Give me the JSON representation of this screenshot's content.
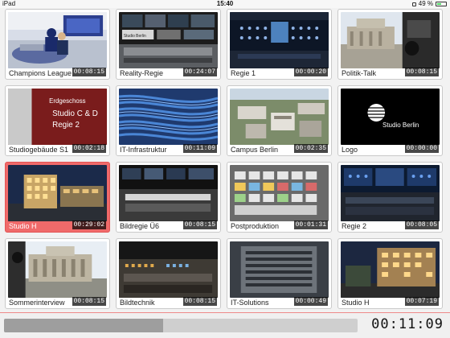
{
  "statusbar": {
    "device": "iPad",
    "time": "15:40",
    "battery_text": "49 %"
  },
  "tiles": [
    {
      "label": "Champions League",
      "duration": "00:08:15",
      "selected": false
    },
    {
      "label": "Reality-Regie",
      "duration": "00:24:07",
      "selected": false
    },
    {
      "label": "Regie 1",
      "duration": "00:00:20",
      "selected": false
    },
    {
      "label": "Politik-Talk",
      "duration": "00:08:15",
      "selected": false
    },
    {
      "label": "Studiogebäude S1",
      "duration": "00:02:18",
      "selected": false,
      "sign_lines": [
        "Erdgeschoss",
        "Studio C & D",
        "Regie 2"
      ]
    },
    {
      "label": "IT-Infrastruktur",
      "duration": "00:11:09",
      "selected": false
    },
    {
      "label": "Campus Berlin",
      "duration": "00:02:35",
      "selected": false
    },
    {
      "label": "Logo",
      "duration": "00:00:00",
      "selected": false,
      "logo_text": "Studio Berlin"
    },
    {
      "label": "Studio H",
      "duration": "00:29:02",
      "selected": true
    },
    {
      "label": "Bildregie Ü6",
      "duration": "00:08:15",
      "selected": false
    },
    {
      "label": "Postproduktion",
      "duration": "00:01:31",
      "selected": false
    },
    {
      "label": "Regie 2",
      "duration": "00:08:05",
      "selected": false
    },
    {
      "label": "Sommerinterview",
      "duration": "00:08:15",
      "selected": false
    },
    {
      "label": "Bildtechnik",
      "duration": "00:08:15",
      "selected": false
    },
    {
      "label": "IT-Solutions",
      "duration": "00:00:49",
      "selected": false
    },
    {
      "label": "Studio H",
      "duration": "00:07:19",
      "selected": false
    }
  ],
  "thumb_text": {
    "reality_sign": "Studio Berlin"
  },
  "playback": {
    "elapsed": "00:11:09",
    "progress_fraction": 0.45
  },
  "colors": {
    "selected_tile": "#f06a6a",
    "battery": "#4cd964"
  }
}
